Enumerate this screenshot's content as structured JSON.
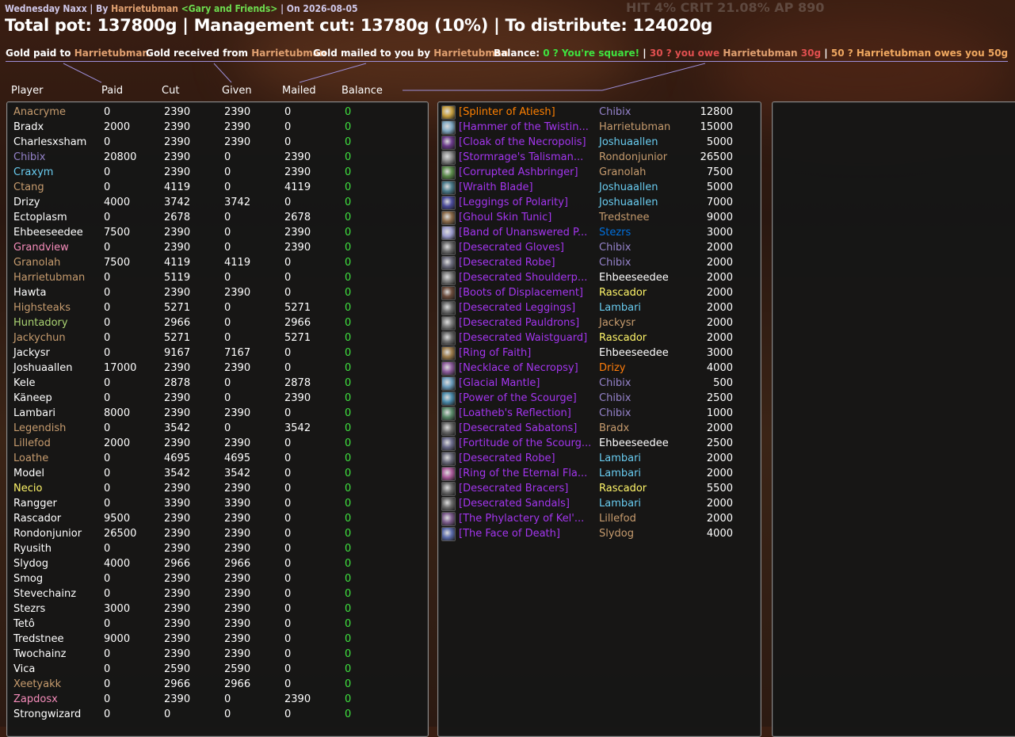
{
  "header": {
    "subtitle": {
      "raid": "Wednesday Naxx",
      "by_label": "| By",
      "leader": "Harrietubman",
      "guild": "<Gary and Friends>",
      "date_label": "| On 2026-08-05"
    },
    "summary": "Total pot: 137800g | Management cut: 13780g (10%) | To distribute: 124020g",
    "stats_overlay": "HIT 4% CRIT 21.08% AP 890"
  },
  "legend": {
    "paid_label": "Gold paid to",
    "paid_name": "Harrietubman",
    "received_label": "Gold received from",
    "received_name": "Harrietubman",
    "mailed_label": "Gold mailed to you by",
    "mailed_name": "Harrietubman",
    "balance_label": "Balance:",
    "balance_square": "0 ? You're square!",
    "balance_sep1": "|",
    "balance_owe_prefix": "30 ? you owe",
    "balance_owe_name": "Harrietubman",
    "balance_owe_amount": "30g",
    "balance_sep2": "|",
    "balance_owed": "50 ? Harrietubman owes you 50g"
  },
  "columns": {
    "player": "Player",
    "paid": "Paid",
    "cut": "Cut",
    "given": "Given",
    "mailed": "Mailed",
    "balance": "Balance"
  },
  "colors": {
    "druid": "#ff7d0a",
    "hunter": "#abd473",
    "mage": "#69ccf0",
    "paladin": "#f58cba",
    "priest": "#ffffff",
    "rogue": "#fff569",
    "shaman": "#0070de",
    "warlock": "#9482c9",
    "warrior": "#c79c6e",
    "epic": "#a335ee",
    "legendary": "#ff8000",
    "balance_zero": "#3fe23f"
  },
  "players": [
    {
      "name": "Anacryme",
      "color": "#c79c6e",
      "paid": "0",
      "cut": "2390",
      "given": "2390",
      "mailed": "0",
      "balance": "0"
    },
    {
      "name": "Bradx",
      "color": "#ffffff",
      "paid": "2000",
      "cut": "2390",
      "given": "2390",
      "mailed": "0",
      "balance": "0"
    },
    {
      "name": "Charlesxsham",
      "color": "#ffffff",
      "paid": "0",
      "cut": "2390",
      "given": "2390",
      "mailed": "0",
      "balance": "0"
    },
    {
      "name": "Chibix",
      "color": "#9482c9",
      "paid": "20800",
      "cut": "2390",
      "given": "0",
      "mailed": "2390",
      "balance": "0"
    },
    {
      "name": "Craxym",
      "color": "#69ccf0",
      "paid": "0",
      "cut": "2390",
      "given": "0",
      "mailed": "2390",
      "balance": "0"
    },
    {
      "name": "Ctang",
      "color": "#c79c6e",
      "paid": "0",
      "cut": "4119",
      "given": "0",
      "mailed": "4119",
      "balance": "0"
    },
    {
      "name": "Drizy",
      "color": "#ffffff",
      "paid": "4000",
      "cut": "3742",
      "given": "3742",
      "mailed": "0",
      "balance": "0"
    },
    {
      "name": "Ectoplasm",
      "color": "#ffffff",
      "paid": "0",
      "cut": "2678",
      "given": "0",
      "mailed": "2678",
      "balance": "0"
    },
    {
      "name": "Ehbeeseedee",
      "color": "#ffffff",
      "paid": "7500",
      "cut": "2390",
      "given": "0",
      "mailed": "2390",
      "balance": "0"
    },
    {
      "name": "Grandview",
      "color": "#f58cba",
      "paid": "0",
      "cut": "2390",
      "given": "0",
      "mailed": "2390",
      "balance": "0"
    },
    {
      "name": "Granolah",
      "color": "#c79c6e",
      "paid": "7500",
      "cut": "4119",
      "given": "4119",
      "mailed": "0",
      "balance": "0"
    },
    {
      "name": "Harrietubman",
      "color": "#c79c6e",
      "paid": "0",
      "cut": "5119",
      "given": "0",
      "mailed": "0",
      "balance": "0"
    },
    {
      "name": "Hawta",
      "color": "#ffffff",
      "paid": "0",
      "cut": "2390",
      "given": "2390",
      "mailed": "0",
      "balance": "0"
    },
    {
      "name": "Highsteaks",
      "color": "#c79c6e",
      "paid": "0",
      "cut": "5271",
      "given": "0",
      "mailed": "5271",
      "balance": "0"
    },
    {
      "name": "Huntadory",
      "color": "#abd473",
      "paid": "0",
      "cut": "2966",
      "given": "0",
      "mailed": "2966",
      "balance": "0"
    },
    {
      "name": "Jackychun",
      "color": "#c79c6e",
      "paid": "0",
      "cut": "5271",
      "given": "0",
      "mailed": "5271",
      "balance": "0"
    },
    {
      "name": "Jackysr",
      "color": "#ffffff",
      "paid": "0",
      "cut": "9167",
      "given": "7167",
      "mailed": "0",
      "balance": "0"
    },
    {
      "name": "Joshuaallen",
      "color": "#ffffff",
      "paid": "17000",
      "cut": "2390",
      "given": "2390",
      "mailed": "0",
      "balance": "0"
    },
    {
      "name": "Kele",
      "color": "#ffffff",
      "paid": "0",
      "cut": "2878",
      "given": "0",
      "mailed": "2878",
      "balance": "0"
    },
    {
      "name": "Käneep",
      "color": "#ffffff",
      "paid": "0",
      "cut": "2390",
      "given": "0",
      "mailed": "2390",
      "balance": "0"
    },
    {
      "name": "Lambari",
      "color": "#ffffff",
      "paid": "8000",
      "cut": "2390",
      "given": "2390",
      "mailed": "0",
      "balance": "0"
    },
    {
      "name": "Legendish",
      "color": "#c79c6e",
      "paid": "0",
      "cut": "3542",
      "given": "0",
      "mailed": "3542",
      "balance": "0"
    },
    {
      "name": "Lillefod",
      "color": "#c79c6e",
      "paid": "2000",
      "cut": "2390",
      "given": "2390",
      "mailed": "0",
      "balance": "0"
    },
    {
      "name": "Loathe",
      "color": "#c79c6e",
      "paid": "0",
      "cut": "4695",
      "given": "4695",
      "mailed": "0",
      "balance": "0"
    },
    {
      "name": "Model",
      "color": "#ffffff",
      "paid": "0",
      "cut": "3542",
      "given": "3542",
      "mailed": "0",
      "balance": "0"
    },
    {
      "name": "Necio",
      "color": "#fff569",
      "paid": "0",
      "cut": "2390",
      "given": "2390",
      "mailed": "0",
      "balance": "0"
    },
    {
      "name": "Rangger",
      "color": "#ffffff",
      "paid": "0",
      "cut": "3390",
      "given": "3390",
      "mailed": "0",
      "balance": "0"
    },
    {
      "name": "Rascador",
      "color": "#ffffff",
      "paid": "9500",
      "cut": "2390",
      "given": "2390",
      "mailed": "0",
      "balance": "0"
    },
    {
      "name": "Rondonjunior",
      "color": "#ffffff",
      "paid": "26500",
      "cut": "2390",
      "given": "2390",
      "mailed": "0",
      "balance": "0"
    },
    {
      "name": "Ryusith",
      "color": "#ffffff",
      "paid": "0",
      "cut": "2390",
      "given": "2390",
      "mailed": "0",
      "balance": "0"
    },
    {
      "name": "Slydog",
      "color": "#ffffff",
      "paid": "4000",
      "cut": "2966",
      "given": "2966",
      "mailed": "0",
      "balance": "0"
    },
    {
      "name": "Smog",
      "color": "#ffffff",
      "paid": "0",
      "cut": "2390",
      "given": "2390",
      "mailed": "0",
      "balance": "0"
    },
    {
      "name": "Stevechainz",
      "color": "#ffffff",
      "paid": "0",
      "cut": "2390",
      "given": "2390",
      "mailed": "0",
      "balance": "0"
    },
    {
      "name": "Stezrs",
      "color": "#ffffff",
      "paid": "3000",
      "cut": "2390",
      "given": "2390",
      "mailed": "0",
      "balance": "0"
    },
    {
      "name": "Tetô",
      "color": "#ffffff",
      "paid": "0",
      "cut": "2390",
      "given": "2390",
      "mailed": "0",
      "balance": "0"
    },
    {
      "name": "Tredstnee",
      "color": "#ffffff",
      "paid": "9000",
      "cut": "2390",
      "given": "2390",
      "mailed": "0",
      "balance": "0"
    },
    {
      "name": "Twochainz",
      "color": "#ffffff",
      "paid": "0",
      "cut": "2390",
      "given": "2390",
      "mailed": "0",
      "balance": "0"
    },
    {
      "name": "Vica",
      "color": "#ffffff",
      "paid": "0",
      "cut": "2590",
      "given": "2590",
      "mailed": "0",
      "balance": "0"
    },
    {
      "name": "Xeetyakk",
      "color": "#c79c6e",
      "paid": "0",
      "cut": "2966",
      "given": "2966",
      "mailed": "0",
      "balance": "0"
    },
    {
      "name": "Zapdosx",
      "color": "#f58cba",
      "paid": "0",
      "cut": "2390",
      "given": "0",
      "mailed": "2390",
      "balance": "0"
    },
    {
      "name": "Strongwizard",
      "color": "#ffffff",
      "paid": "0",
      "cut": "0",
      "given": "0",
      "mailed": "0",
      "balance": "0"
    }
  ],
  "loot": [
    {
      "item": "[Splinter of Atiesh]",
      "item_color": "#ff8000",
      "icon": "splinter-icon",
      "icon_color": "#c8a040",
      "winner": "Chibix",
      "winner_color": "#9482c9",
      "price": "12800"
    },
    {
      "item": "[Hammer of the Twistin...",
      "item_color": "#a335ee",
      "icon": "hammer-icon",
      "icon_color": "#7fa7c0",
      "winner": "Harrietubman",
      "winner_color": "#c79c6e",
      "price": "15000"
    },
    {
      "item": "[Cloak of the Necropolis]",
      "item_color": "#a335ee",
      "icon": "cloak-icon",
      "icon_color": "#6a3a8a",
      "winner": "Joshuaallen",
      "winner_color": "#69ccf0",
      "price": "5000"
    },
    {
      "item": "[Stormrage's Talisman...",
      "item_color": "#a335ee",
      "icon": "talisman-icon",
      "icon_color": "#8a8a8a",
      "winner": "Rondonjunior",
      "winner_color": "#c79c6e",
      "price": "26500"
    },
    {
      "item": "[Corrupted Ashbringer]",
      "item_color": "#a335ee",
      "icon": "sword-icon",
      "icon_color": "#5a8a4a",
      "winner": "Granolah",
      "winner_color": "#c79c6e",
      "price": "7500"
    },
    {
      "item": "[Wraith Blade]",
      "item_color": "#a335ee",
      "icon": "blade-icon",
      "icon_color": "#4a7a8a",
      "winner": "Joshuaallen",
      "winner_color": "#69ccf0",
      "price": "5000"
    },
    {
      "item": "[Leggings of Polarity]",
      "item_color": "#a335ee",
      "icon": "leggings-icon",
      "icon_color": "#4a4a9a",
      "winner": "Joshuaallen",
      "winner_color": "#69ccf0",
      "price": "7000"
    },
    {
      "item": "[Ghoul Skin Tunic]",
      "item_color": "#a335ee",
      "icon": "tunic-icon",
      "icon_color": "#8a6a4a",
      "winner": "Tredstnee",
      "winner_color": "#c79c6e",
      "price": "9000"
    },
    {
      "item": "[Band of Unanswered P...",
      "item_color": "#a335ee",
      "icon": "ring-icon",
      "icon_color": "#9a9aca",
      "winner": "Stezrs",
      "winner_color": "#0070de",
      "price": "3000"
    },
    {
      "item": "[Desecrated Gloves]",
      "item_color": "#a335ee",
      "icon": "gloves-icon",
      "icon_color": "#6a6a6a",
      "winner": "Chibix",
      "winner_color": "#9482c9",
      "price": "2000"
    },
    {
      "item": "[Desecrated Robe]",
      "item_color": "#a335ee",
      "icon": "robe-icon",
      "icon_color": "#6a6a7a",
      "winner": "Chibix",
      "winner_color": "#9482c9",
      "price": "2000"
    },
    {
      "item": "[Desecrated Shoulderp...",
      "item_color": "#a335ee",
      "icon": "shoulder-icon",
      "icon_color": "#7a7a7a",
      "winner": "Ehbeeseedee",
      "winner_color": "#ffffff",
      "price": "2000"
    },
    {
      "item": "[Boots of Displacement]",
      "item_color": "#a335ee",
      "icon": "boots-icon",
      "icon_color": "#6a4a3a",
      "winner": "Rascador",
      "winner_color": "#fff569",
      "price": "2000"
    },
    {
      "item": "[Desecrated Leggings]",
      "item_color": "#a335ee",
      "icon": "leggings-icon",
      "icon_color": "#6a6a6a",
      "winner": "Lambari",
      "winner_color": "#69ccf0",
      "price": "2000"
    },
    {
      "item": "[Desecrated Pauldrons]",
      "item_color": "#a335ee",
      "icon": "pauldrons-icon",
      "icon_color": "#7a7a7a",
      "winner": "Jackysr",
      "winner_color": "#c79c6e",
      "price": "2000"
    },
    {
      "item": "[Desecrated Waistguard]",
      "item_color": "#a335ee",
      "icon": "belt-icon",
      "icon_color": "#6a6a6a",
      "winner": "Rascador",
      "winner_color": "#fff569",
      "price": "2000"
    },
    {
      "item": "[Ring of Faith]",
      "item_color": "#a335ee",
      "icon": "ring-icon",
      "icon_color": "#9a7a4a",
      "winner": "Ehbeeseedee",
      "winner_color": "#ffffff",
      "price": "3000"
    },
    {
      "item": "[Necklace of Necropsy]",
      "item_color": "#a335ee",
      "icon": "necklace-icon",
      "icon_color": "#8a5a9a",
      "winner": "Drizy",
      "winner_color": "#ff7d0a",
      "price": "4000"
    },
    {
      "item": "[Glacial Mantle]",
      "item_color": "#a335ee",
      "icon": "mantle-icon",
      "icon_color": "#6a9aba",
      "winner": "Chibix",
      "winner_color": "#9482c9",
      "price": "500"
    },
    {
      "item": "[Power of the Scourge]",
      "item_color": "#a335ee",
      "icon": "orb-icon",
      "icon_color": "#4a8aaa",
      "winner": "Chibix",
      "winner_color": "#9482c9",
      "price": "2500"
    },
    {
      "item": "[Loatheb's Reflection]",
      "item_color": "#a335ee",
      "icon": "trinket-icon",
      "icon_color": "#5a8a6a",
      "winner": "Chibix",
      "winner_color": "#9482c9",
      "price": "1000"
    },
    {
      "item": "[Desecrated Sabatons]",
      "item_color": "#a335ee",
      "icon": "boots-icon",
      "icon_color": "#6a6a6a",
      "winner": "Bradx",
      "winner_color": "#c79c6e",
      "price": "2000"
    },
    {
      "item": "[Fortitude of the Scourg...",
      "item_color": "#a335ee",
      "icon": "orb-icon",
      "icon_color": "#6a6a8a",
      "winner": "Ehbeeseedee",
      "winner_color": "#ffffff",
      "price": "2500"
    },
    {
      "item": "[Desecrated Robe]",
      "item_color": "#a335ee",
      "icon": "robe-icon",
      "icon_color": "#6a6a7a",
      "winner": "Lambari",
      "winner_color": "#69ccf0",
      "price": "2000"
    },
    {
      "item": "[Ring of the Eternal Fla...",
      "item_color": "#a335ee",
      "icon": "ring-icon",
      "icon_color": "#aa5a9a",
      "winner": "Lambari",
      "winner_color": "#69ccf0",
      "price": "2000"
    },
    {
      "item": "[Desecrated Bracers]",
      "item_color": "#a335ee",
      "icon": "bracers-icon",
      "icon_color": "#6a6a6a",
      "winner": "Rascador",
      "winner_color": "#fff569",
      "price": "5500"
    },
    {
      "item": "[Desecrated Sandals]",
      "item_color": "#a335ee",
      "icon": "sandals-icon",
      "icon_color": "#6a6a6a",
      "winner": "Lambari",
      "winner_color": "#69ccf0",
      "price": "2000"
    },
    {
      "item": "[The Phylactery of Kel'...",
      "item_color": "#a335ee",
      "icon": "phylactery-icon",
      "icon_color": "#7a5a8a",
      "winner": "Lillefod",
      "winner_color": "#c79c6e",
      "price": "2000"
    },
    {
      "item": "[The Face of Death]",
      "item_color": "#a335ee",
      "icon": "shield-icon",
      "icon_color": "#5a6aaa",
      "winner": "Slydog",
      "winner_color": "#c79c6e",
      "price": "4000"
    }
  ]
}
